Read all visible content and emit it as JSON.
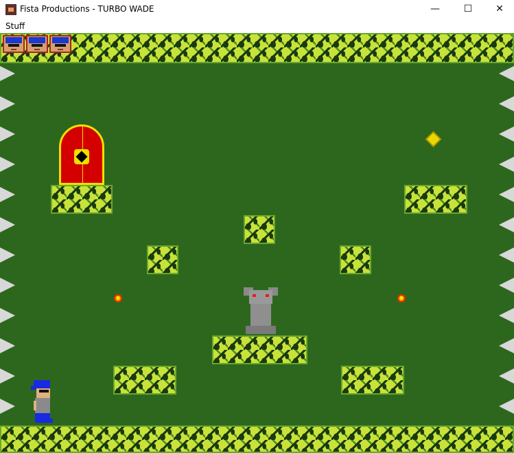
{
  "window": {
    "title": "Fista Productions - TURBO WADE",
    "controls": {
      "minimize": "—",
      "maximize": "☐",
      "close": "✕"
    }
  },
  "menu": {
    "items": [
      {
        "label": "Stuff"
      }
    ]
  },
  "game": {
    "background_color": "#2d671e",
    "lives_count": 3,
    "entities": [
      "player",
      "gargoyle",
      "door",
      "gem",
      "flame",
      "flame"
    ],
    "colors": {
      "bush": "#c8e23a",
      "bush_dark": "#1a3a10",
      "spike": "#d8d8d8",
      "door": "#d40000",
      "door_trim": "#f0e000",
      "player_cap": "#1a2ae0",
      "gargoyle": "#8f8f8f"
    }
  }
}
